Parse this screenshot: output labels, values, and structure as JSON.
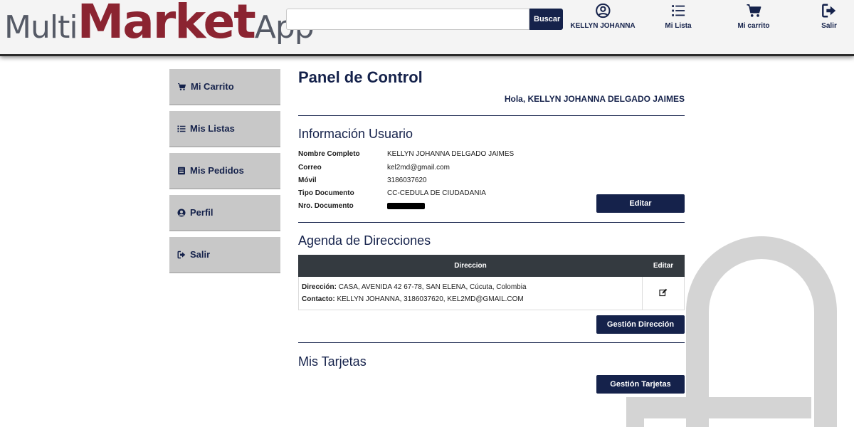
{
  "header": {
    "logo": {
      "part1": "Multi",
      "part2": "Market",
      "part3": "App"
    },
    "search": {
      "placeholder": "",
      "button_label": "Buscar"
    },
    "nav": {
      "user": {
        "label": "KELLYN JOHANNA",
        "icon": "user-circle-icon"
      },
      "list": {
        "label": "Mi Lista",
        "icon": "list-icon"
      },
      "cart": {
        "label": "Mi carrito",
        "icon": "cart-icon"
      },
      "logout": {
        "label": "Salir",
        "icon": "sign-out-icon"
      }
    }
  },
  "sidebar": {
    "items": [
      {
        "label": "Mi Carrito",
        "icon": "cart-icon"
      },
      {
        "label": "Mis Listas",
        "icon": "list-icon"
      },
      {
        "label": "Mis Pedidos",
        "icon": "document-icon"
      },
      {
        "label": "Perfil",
        "icon": "user-circle-icon"
      },
      {
        "label": "Salir",
        "icon": "sign-out-icon"
      }
    ]
  },
  "main": {
    "title": "Panel de Control",
    "greeting": "Hola, KELLYN JOHANNA DELGADO JAIMES",
    "user_info": {
      "title": "Información Usuario",
      "rows": [
        {
          "label": "Nombre Completo",
          "value": "KELLYN JOHANNA DELGADO JAIMES"
        },
        {
          "label": "Correo",
          "value": "kel2md@gmail.com"
        },
        {
          "label": "Móvil",
          "value": "3186037620"
        },
        {
          "label": "Tipo Documento",
          "value": "CC-CEDULA DE CIUDADANIA"
        },
        {
          "label": "Nro. Documento",
          "value": ""
        }
      ],
      "edit_label": "Editar"
    },
    "addresses": {
      "title": "Agenda de Direcciones",
      "columns": [
        "Direccion",
        "Editar"
      ],
      "rows": [
        {
          "address_key": "Dirección:",
          "address_value": "CASA, AVENIDA 42 67-78, SAN ELENA, Cúcuta, Colombia",
          "contact_key": "Contacto:",
          "contact_value": "KELLYN JOHANNA, 3186037620, KEL2MD@GMAIL.COM"
        }
      ],
      "manage_label": "Gestión Dirección"
    },
    "cards": {
      "title": "Mis Tarjetas",
      "manage_label": "Gestión Tarjetas"
    }
  },
  "colors": {
    "primary": "#15224b",
    "logo_accent": "#8b2431",
    "logo_gray": "#555a66",
    "sidebar_bg": "#c8c8c8",
    "table_header": "#343a40",
    "watermark": "#d4d4d4"
  }
}
